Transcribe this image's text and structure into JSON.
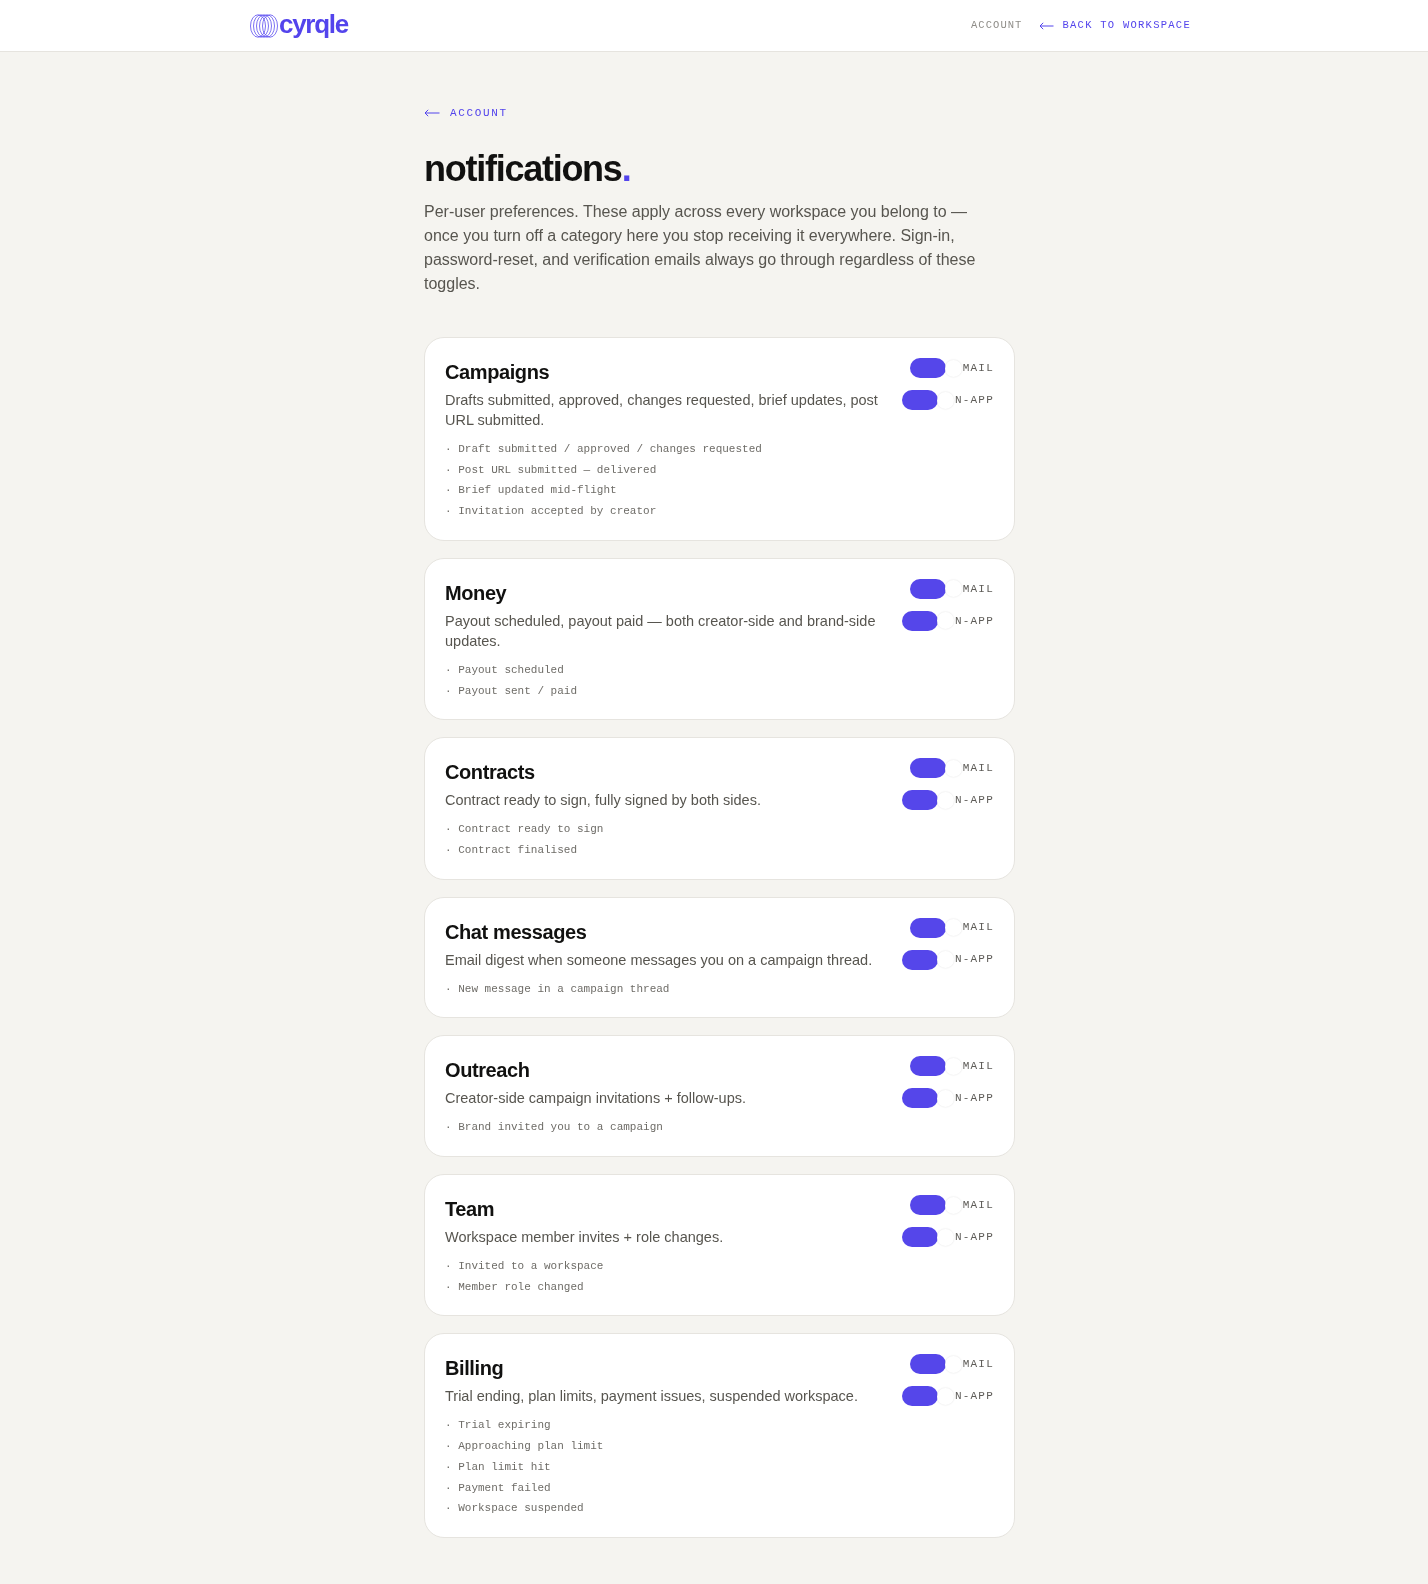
{
  "header": {
    "logo_text": "cyrqle",
    "nav": [
      {
        "label": "ACCOUNT",
        "kind": "text"
      },
      {
        "label": "BACK TO WORKSPACE",
        "kind": "back-link"
      }
    ]
  },
  "breadcrumb": {
    "label": "ACCOUNT"
  },
  "title": "notifications",
  "title_mark": ".",
  "intro": "Per-user preferences. These apply across every workspace you belong to — once you turn off a category here you stop receiving it everywhere. Sign-in, password-reset, and verification emails always go through regardless of these toggles.",
  "categories": [
    {
      "title": "Campaigns",
      "description": "Drafts submitted, approved, changes requested, brief updates, post URL submitted.",
      "events": [
        "· Draft submitted / approved / changes requested",
        "· Post URL submitted — delivered",
        "· Brief updated mid-flight",
        "· Invitation accepted by creator"
      ],
      "toggles": [
        {
          "label": "MAIL",
          "on": true
        },
        {
          "label": "N-APP",
          "on": true
        }
      ]
    },
    {
      "title": "Money",
      "description": "Payout scheduled, payout paid — both creator-side and brand-side updates.",
      "events": [
        "· Payout scheduled",
        "· Payout sent / paid"
      ],
      "toggles": [
        {
          "label": "MAIL",
          "on": true
        },
        {
          "label": "N-APP",
          "on": true
        }
      ]
    },
    {
      "title": "Contracts",
      "description": "Contract ready to sign, fully signed by both sides.",
      "events": [
        "· Contract ready to sign",
        "· Contract finalised"
      ],
      "toggles": [
        {
          "label": "MAIL",
          "on": true
        },
        {
          "label": "N-APP",
          "on": true
        }
      ]
    },
    {
      "title": "Chat messages",
      "description": "Email digest when someone messages you on a campaign thread.",
      "events": [
        "· New message in a campaign thread"
      ],
      "toggles": [
        {
          "label": "MAIL",
          "on": true
        },
        {
          "label": "N-APP",
          "on": true
        }
      ]
    },
    {
      "title": "Outreach",
      "description": "Creator-side campaign invitations + follow-ups.",
      "events": [
        "· Brand invited you to a campaign"
      ],
      "toggles": [
        {
          "label": "MAIL",
          "on": true
        },
        {
          "label": "N-APP",
          "on": true
        }
      ]
    },
    {
      "title": "Team",
      "description": "Workspace member invites + role changes.",
      "events": [
        "· Invited to a workspace",
        "· Member role changed"
      ],
      "toggles": [
        {
          "label": "MAIL",
          "on": true
        },
        {
          "label": "N-APP",
          "on": true
        }
      ]
    },
    {
      "title": "Billing",
      "description": "Trial ending, plan limits, payment issues, suspended workspace.",
      "events": [
        "· Trial expiring",
        "· Approaching plan limit",
        "· Plan limit hit",
        "· Payment failed",
        "· Workspace suspended"
      ],
      "toggles": [
        {
          "label": "MAIL",
          "on": true
        },
        {
          "label": "N-APP",
          "on": true
        }
      ]
    }
  ]
}
